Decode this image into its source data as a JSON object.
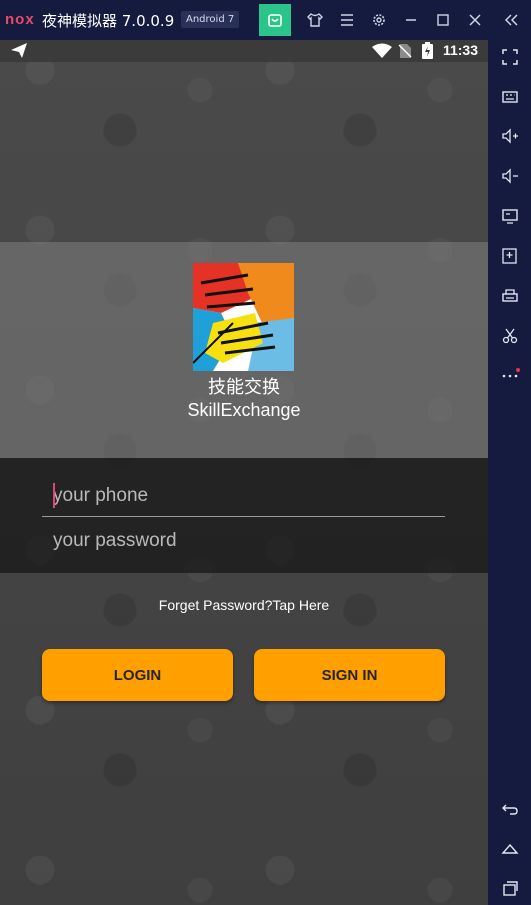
{
  "emulator": {
    "logo": "nox",
    "title": "夜神模拟器 7.0.0.9",
    "android_badge": "Android 7",
    "toolbar_icons": [
      "shop-icon",
      "shirt-icon",
      "menu-icon",
      "gear-icon",
      "minimize-icon",
      "maximize-icon",
      "close-icon",
      "collapse-icon"
    ],
    "sidebar_icons": [
      "fullscreen-icon",
      "keyboard-icon",
      "volume-up-icon",
      "volume-down-icon",
      "screen-icon",
      "apk-icon",
      "print-icon",
      "scissors-icon",
      "more-icon",
      "back-icon",
      "home-icon",
      "recent-icon"
    ],
    "accent": "#2bc48a"
  },
  "statusbar": {
    "time": "11:33"
  },
  "app": {
    "name_cn": "技能交换",
    "name_en": "SkillExchange"
  },
  "form": {
    "phone_placeholder": "your phone",
    "password_placeholder": "your password"
  },
  "forget_text": "Forget Password?Tap Here",
  "buttons": {
    "login": "LOGIN",
    "sign_in": "SIGN IN",
    "color": "#ffa000"
  }
}
